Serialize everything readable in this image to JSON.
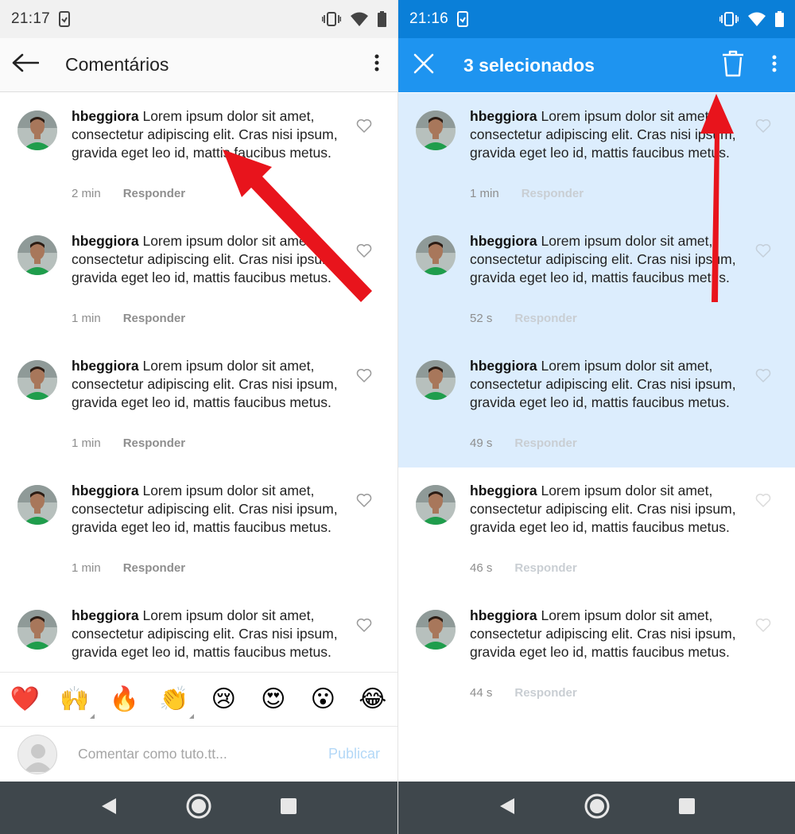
{
  "left": {
    "status": {
      "time": "21:17"
    },
    "appbar": {
      "title": "Comentários"
    },
    "comments": [
      {
        "user": "hbeggiora",
        "text": "Lorem ipsum dolor sit amet, consectetur adipiscing elit. Cras nisi ipsum, gravida eget leo id, mattis faucibus metus.",
        "time": "2 min",
        "reply": "Responder"
      },
      {
        "user": "hbeggiora",
        "text": "Lorem ipsum dolor sit amet, consectetur adipiscing elit. Cras nisi ipsum, gravida eget leo id, mattis faucibus metus.",
        "time": "1 min",
        "reply": "Responder"
      },
      {
        "user": "hbeggiora",
        "text": "Lorem ipsum dolor sit amet, consectetur adipiscing elit. Cras nisi ipsum, gravida eget leo id, mattis faucibus metus.",
        "time": "1 min",
        "reply": "Responder"
      },
      {
        "user": "hbeggiora",
        "text": "Lorem ipsum dolor sit amet, consectetur adipiscing elit. Cras nisi ipsum, gravida eget leo id, mattis faucibus metus.",
        "time": "1 min",
        "reply": "Responder"
      },
      {
        "user": "hbeggiora",
        "text": "Lorem ipsum dolor sit amet, consectetur adipiscing elit. Cras nisi ipsum, gravida eget leo id, mattis faucibus metus.",
        "time": "",
        "reply": ""
      }
    ],
    "emojis": [
      "❤️",
      "🙌",
      "🔥",
      "👏",
      "😢",
      "😍",
      "😮",
      "😂"
    ],
    "composer": {
      "placeholder": "Comentar como tuto.tt...",
      "publish": "Publicar"
    }
  },
  "right": {
    "status": {
      "time": "21:16"
    },
    "appbar": {
      "title": "3 selecionados"
    },
    "comments": [
      {
        "user": "hbeggiora",
        "text": "Lorem ipsum dolor sit amet, consectetur adipiscing elit. Cras nisi ipsum, gravida eget leo id, mattis faucibus metus.",
        "time": "1 min",
        "reply": "Responder",
        "selected": true
      },
      {
        "user": "hbeggiora",
        "text": "Lorem ipsum dolor sit amet, consectetur adipiscing elit. Cras nisi ipsum, gravida eget leo id, mattis faucibus metus.",
        "time": "52 s",
        "reply": "Responder",
        "selected": true
      },
      {
        "user": "hbeggiora",
        "text": "Lorem ipsum dolor sit amet, consectetur adipiscing elit. Cras nisi ipsum, gravida eget leo id, mattis faucibus metus.",
        "time": "49 s",
        "reply": "Responder",
        "selected": true
      },
      {
        "user": "hbeggiora",
        "text": "Lorem ipsum dolor sit amet, consectetur adipiscing elit. Cras nisi ipsum, gravida eget leo id, mattis faucibus metus.",
        "time": "46 s",
        "reply": "Responder",
        "selected": false
      },
      {
        "user": "hbeggiora",
        "text": "Lorem ipsum dolor sit amet, consectetur adipiscing elit. Cras nisi ipsum, gravida eget leo id, mattis faucibus metus.",
        "time": "44 s",
        "reply": "Responder",
        "selected": false
      }
    ]
  },
  "colors": {
    "accent": "#1e94f0",
    "status_blue": "#0a7fd8",
    "selected_bg": "#dcedfd",
    "arrow": "#e8141c",
    "navbar": "#3f474c"
  },
  "icons": [
    "back-arrow-icon",
    "more-vert-icon",
    "close-icon",
    "trash-icon",
    "heart-icon",
    "vibrate-icon",
    "wifi-icon",
    "battery-icon",
    "nav-back-icon",
    "nav-home-icon",
    "nav-recents-icon"
  ]
}
